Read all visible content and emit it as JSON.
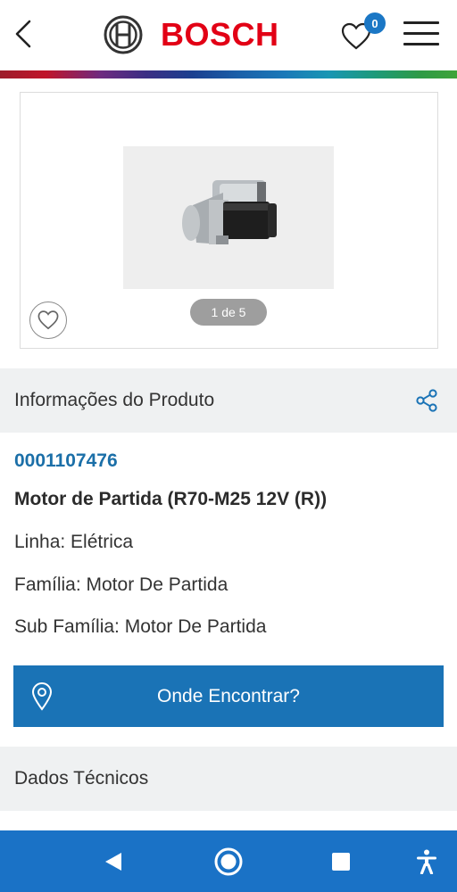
{
  "header": {
    "brand": "BOSCH",
    "favorites_count": "0",
    "back_icon": "chevron-left-icon",
    "favorites_icon": "heart-icon",
    "menu_icon": "hamburger-menu-icon"
  },
  "gallery": {
    "pager_text": "1 de 5",
    "wishlist_icon": "heart-outline-icon"
  },
  "info_section": {
    "title": "Informações do Produto",
    "share_icon": "share-icon"
  },
  "product": {
    "code": "0001107476",
    "name": "Motor de Partida (R70-M25 12V (R))",
    "line": "Linha: Elétrica",
    "family": "Família: Motor De Partida",
    "subfamily": "Sub Família: Motor De Partida"
  },
  "cta": {
    "label": "Onde Encontrar?",
    "icon": "location-pin-icon"
  },
  "tech_section": {
    "title": "Dados Técnicos"
  },
  "system_nav": {
    "back": "back-triangle-icon",
    "home": "home-circle-icon",
    "recents": "recents-square-icon",
    "accessibility": "accessibility-icon"
  },
  "colors": {
    "brand_red": "#e20015",
    "accent_blue": "#1a73b6",
    "code_blue": "#1b6fa8",
    "nav_blue": "#1a72c6",
    "section_bg": "#eff1f2"
  }
}
